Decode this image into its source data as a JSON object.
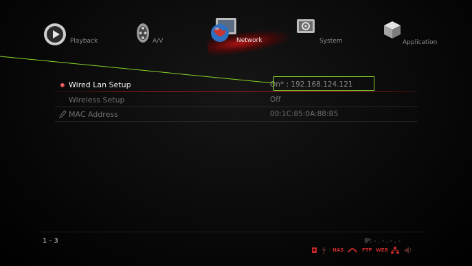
{
  "nav": {
    "playback": "Playback",
    "av": "A/V",
    "network": "Network",
    "system": "System",
    "application": "Application"
  },
  "settings": [
    {
      "label": "Wired Lan Setup",
      "value": "On* : 192.168.124.121"
    },
    {
      "label": "Wireless Setup",
      "value": "Off"
    },
    {
      "label": "MAC Address",
      "value": "00:1C:85:0A:88:B5"
    }
  ],
  "footer": {
    "page_range": "1 - 3",
    "ip": "IP: - . - . - . -",
    "status_nas": "NAS",
    "status_ftp": "FTP",
    "status_web": "WEB"
  },
  "colors": {
    "accent": "#9a1b1b",
    "highlight_box": "#8ad62b",
    "status_red": "#c42a2a"
  },
  "icons": {
    "playback": "play-disc-icon",
    "av": "film-reel-icon",
    "network": "globe-icon",
    "system": "settings-panel-icon",
    "application": "cube-icon",
    "mac": "pencil-icon"
  }
}
